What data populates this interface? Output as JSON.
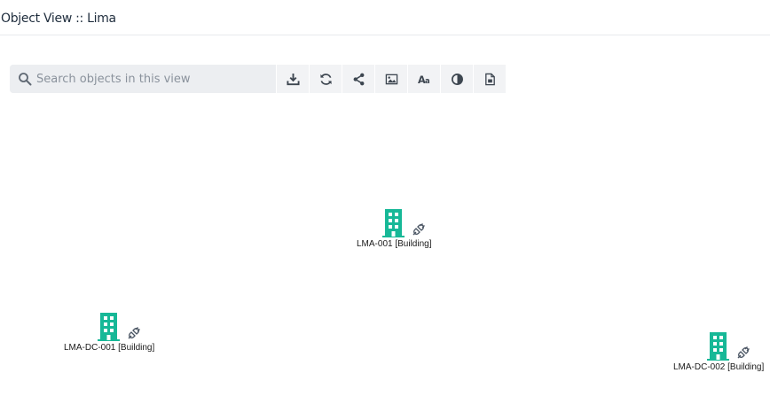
{
  "header": {
    "title": "Object View :: Lima"
  },
  "toolbar": {
    "search_placeholder": "Search objects in this view",
    "buttons": [
      {
        "icon": "download-icon"
      },
      {
        "icon": "refresh-icon"
      },
      {
        "icon": "share-icon"
      },
      {
        "icon": "image-icon"
      },
      {
        "icon": "font-size-icon"
      },
      {
        "icon": "contrast-icon"
      },
      {
        "icon": "export-document-icon"
      }
    ]
  },
  "nodes": [
    {
      "label": "LMA-001 [Building]",
      "icon": "building-icon",
      "status_icon": "plug-icon"
    },
    {
      "label": "LMA-DC-001 [Building]",
      "icon": "building-icon",
      "status_icon": "plug-icon"
    },
    {
      "label": "LMA-DC-002 [Building]",
      "icon": "building-icon",
      "status_icon": "plug-icon"
    }
  ],
  "colors": {
    "building": "#17b897",
    "icon": "#4a5563"
  }
}
